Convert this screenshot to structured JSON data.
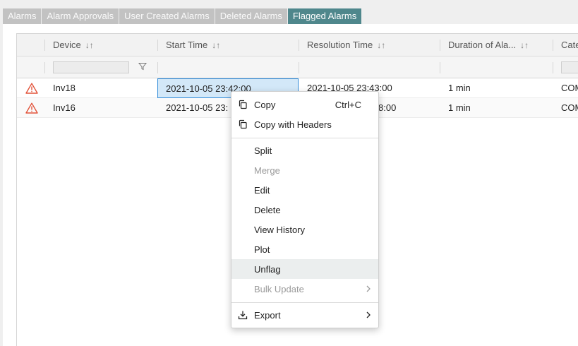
{
  "tabs": [
    {
      "label": "Alarms",
      "active": false
    },
    {
      "label": "Alarm Approvals",
      "active": false
    },
    {
      "label": "User Created Alarms",
      "active": false
    },
    {
      "label": "Deleted Alarms",
      "active": false
    },
    {
      "label": "Flagged Alarms",
      "active": true
    }
  ],
  "table": {
    "columns": {
      "device": "Device",
      "start_time": "Start Time",
      "resolution_time": "Resolution Time",
      "duration": "Duration of Ala...",
      "category": "Cate"
    },
    "sort_glyph": "↓↑",
    "rows": [
      {
        "device": "Inv18",
        "start_time": "2021-10-05 23:42:00",
        "resolution_time": "2021-10-05 23:43:00",
        "duration": "1 min",
        "category": "COM"
      },
      {
        "device": "Inv16",
        "start_time": "2021-10-05 23:",
        "resolution_time": "8:00",
        "duration": "1 min",
        "category": "COM"
      }
    ]
  },
  "context_menu": {
    "copy": {
      "label": "Copy",
      "shortcut": "Ctrl+C"
    },
    "copy_headers": {
      "label": "Copy with Headers"
    },
    "split": {
      "label": "Split"
    },
    "merge": {
      "label": "Merge",
      "disabled": true
    },
    "edit": {
      "label": "Edit"
    },
    "delete": {
      "label": "Delete"
    },
    "view_history": {
      "label": "View History"
    },
    "plot": {
      "label": "Plot"
    },
    "unflag": {
      "label": "Unflag",
      "hovered": true
    },
    "bulk_update": {
      "label": "Bulk Update",
      "disabled": true
    },
    "export": {
      "label": "Export"
    }
  },
  "colors": {
    "active_tab": "#4f878c",
    "inactive_tab": "#c2c2c2",
    "selection_fill": "#d3e8f8",
    "selection_border": "#2f8ad8",
    "warning_icon": "#e2533a"
  }
}
